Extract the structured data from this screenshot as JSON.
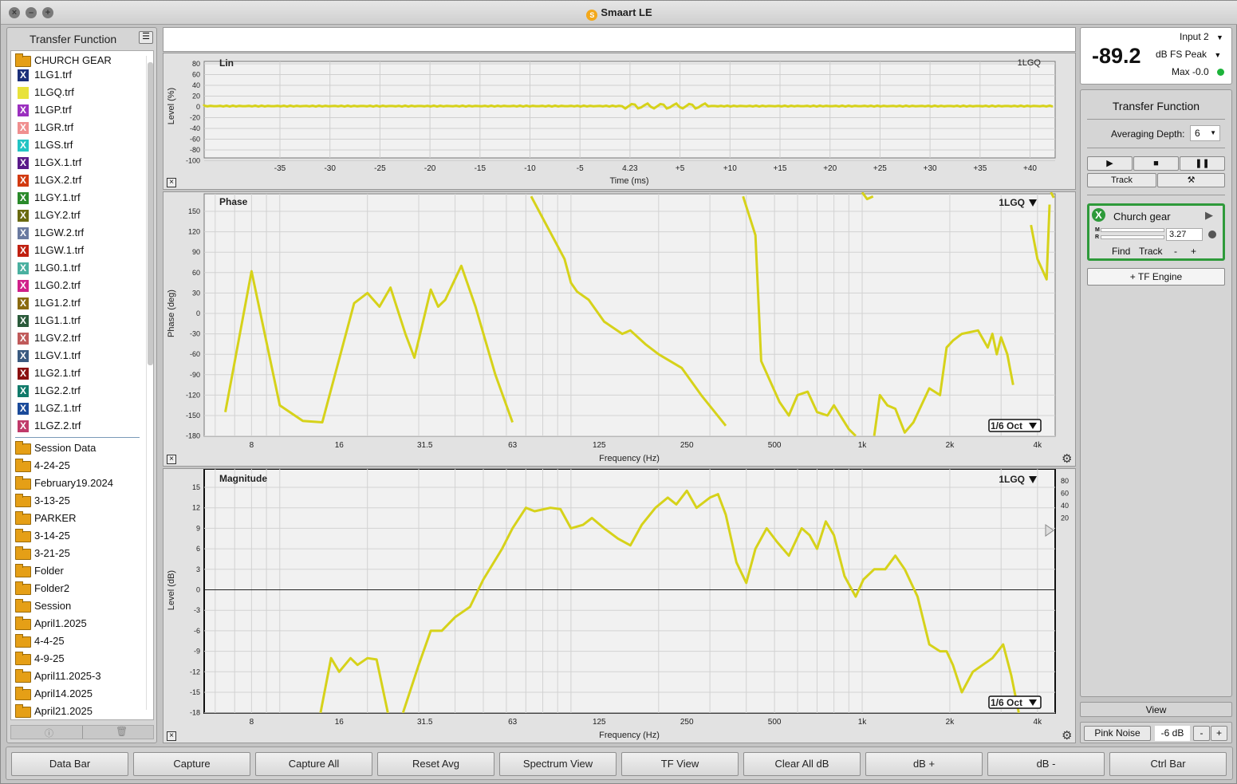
{
  "window": {
    "title": "Smaart LE"
  },
  "sidebar": {
    "title": "Transfer Function",
    "root": "CHURCH GEAR",
    "files": [
      {
        "name": "1LG1.trf",
        "color": "#1b2f7a"
      },
      {
        "name": "1LGQ.trf",
        "color": "#e8e23a"
      },
      {
        "name": "1LGP.trf",
        "color": "#9b2fbf"
      },
      {
        "name": "1LGR.trf",
        "color": "#f08f8f"
      },
      {
        "name": "1LGS.trf",
        "color": "#22c4c4"
      },
      {
        "name": "1LGX.1.trf",
        "color": "#5a1a8a"
      },
      {
        "name": "1LGX.2.trf",
        "color": "#d23a10"
      },
      {
        "name": "1LGY.1.trf",
        "color": "#2a8a2a"
      },
      {
        "name": "1LGY.2.trf",
        "color": "#6a6a10"
      },
      {
        "name": "1LGW.2.trf",
        "color": "#6a7aa0"
      },
      {
        "name": "1LGW.1.trf",
        "color": "#c02010"
      },
      {
        "name": "1LG0.1.trf",
        "color": "#4ab0a0"
      },
      {
        "name": "1LG0.2.trf",
        "color": "#d0208a"
      },
      {
        "name": "1LG1.2.trf",
        "color": "#8a6a10"
      },
      {
        "name": "1LG1.1.trf",
        "color": "#2a5a3a"
      },
      {
        "name": "1LGV.2.trf",
        "color": "#c05a5a"
      },
      {
        "name": "1LGV.1.trf",
        "color": "#3a5a80"
      },
      {
        "name": "1LG2.1.trf",
        "color": "#8a1010"
      },
      {
        "name": "1LG2.2.trf",
        "color": "#107a6a"
      },
      {
        "name": "1LGZ.1.trf",
        "color": "#1a4a9a"
      },
      {
        "name": "1LGZ.2.trf",
        "color": "#c03a6a"
      }
    ],
    "folders": [
      "Session Data",
      "4-24-25",
      "February19.2024",
      "3-13-25",
      "PARKER",
      "3-14-25",
      "3-21-25",
      "Folder",
      "Folder2",
      "Session",
      "April1.2025",
      "4-4-25",
      "4-9-25",
      "April11.2025-3",
      "April14.2025",
      "April21.2025"
    ]
  },
  "impulse": {
    "mode": "Lin",
    "trace": "1LGQ",
    "ylabel": "Level (%)",
    "xlabel": "Time (ms)",
    "yticks": [
      "80",
      "60",
      "40",
      "20",
      "0",
      "-20",
      "-40",
      "-60",
      "-80",
      "-100"
    ],
    "xticks": [
      "-35",
      "-30",
      "-25",
      "-20",
      "-15",
      "-10",
      "-5",
      "4.23",
      "+5",
      "+10",
      "+15",
      "+20",
      "+25",
      "+30",
      "+35",
      "+40"
    ]
  },
  "phase": {
    "mode": "Phase",
    "trace": "1LGQ",
    "ylabel": "Phase (deg)",
    "xlabel": "Frequency (Hz)",
    "smoothing": "1/6 Oct",
    "yticks": [
      "150",
      "120",
      "90",
      "60",
      "30",
      "0",
      "-30",
      "-60",
      "-90",
      "-120",
      "-150",
      "-180"
    ],
    "xticks": [
      "8",
      "16",
      "31.5",
      "63",
      "125",
      "250",
      "500",
      "1k",
      "2k",
      "4k"
    ]
  },
  "magnitude": {
    "mode": "Magnitude",
    "trace": "1LGQ",
    "ylabel": "Level (dB)",
    "xlabel": "Frequency (Hz)",
    "smoothing": "1/6 Oct",
    "yticks": [
      "15",
      "12",
      "9",
      "6",
      "3",
      "0",
      "-3",
      "-6",
      "-9",
      "-12",
      "-15",
      "-18"
    ],
    "xticks": [
      "8",
      "16",
      "31.5",
      "63",
      "125",
      "250",
      "500",
      "1k",
      "2k",
      "4k"
    ],
    "right_ticks": [
      "80",
      "60",
      "40",
      "20"
    ]
  },
  "meter": {
    "value": "-89.2",
    "input": "Input 2",
    "unit": "dB FS Peak",
    "max": "Max -0.0",
    "status_color": "#1db33a"
  },
  "tf_panel": {
    "title": "Transfer Function",
    "avg_label": "Averaging Depth:",
    "avg_value": "6",
    "track_label": "Track",
    "engine": {
      "name": "Church gear",
      "delay": "3.27",
      "find": "Find",
      "track": "Track",
      "minus": "-",
      "plus": "+"
    },
    "add_engine": "+ TF Engine"
  },
  "view_label": "View",
  "generator": {
    "label": "Pink Noise",
    "level": "-6 dB",
    "minus": "-",
    "plus": "+"
  },
  "bottom_buttons": [
    "Data Bar",
    "Capture",
    "Capture All",
    "Reset Avg",
    "Spectrum View",
    "TF View",
    "Clear All dB",
    "dB +",
    "dB -",
    "Ctrl Bar"
  ],
  "trace_color": "#d6d21a"
}
